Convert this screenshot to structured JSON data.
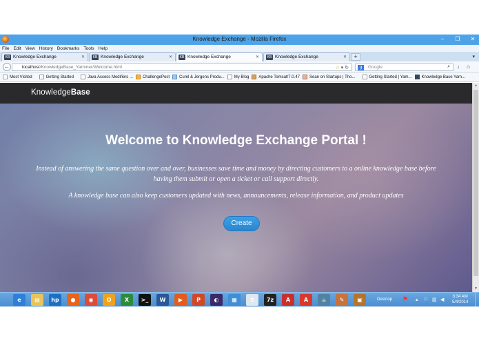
{
  "window": {
    "title": "Knowledge Exchange - Mozilla Firefox",
    "controls": [
      "–",
      "❐",
      "✕"
    ]
  },
  "menu": [
    "File",
    "Edit",
    "View",
    "History",
    "Bookmarks",
    "Tools",
    "Help"
  ],
  "tabs": [
    {
      "label": "Knowledge Exchange",
      "active": false
    },
    {
      "label": "Knowledge Exchange",
      "active": false
    },
    {
      "label": "Knowledge Exchange",
      "active": true
    },
    {
      "label": "Knowledge Exchange",
      "active": false
    }
  ],
  "tab_favicon": "KB",
  "address": {
    "host": "localhost",
    "path": "/KnowledgeBase_Yammer/Welcome.html"
  },
  "search": {
    "placeholder": "Google",
    "engine_icon": "g"
  },
  "bookmarks": [
    "Most Visited",
    "Getting Started",
    "Java Access Modifiers ...",
    "ChallengePost",
    "Curel & Jergens Produ...",
    "My Blog",
    "Apache Tomcat/7.0.47",
    "Sean on Startups | Tho...",
    "Getting Started | Yam...",
    "Knowledge Base Yam..."
  ],
  "site": {
    "brand_light": "Knowledge",
    "brand_bold": "Base",
    "hero_title": "Welcome to Knowledge Exchange Portal !",
    "hero_text_1": "Instead of answering the same question over and over, businesses save time and money by directing customers to a online knowledge base before having them submit or open a ticket or call support directly.",
    "hero_text_2": "A knowledge base can also keep customers updated with news, announcements, release information, and product updates",
    "create_label": "Create"
  },
  "taskbar": {
    "apps": [
      "internet-explorer",
      "file-explorer",
      "hp",
      "firefox",
      "chrome",
      "outlook",
      "excel",
      "command-prompt",
      "word",
      "media-player",
      "powerpoint",
      "eclipse",
      "network",
      "notepad",
      "7zip",
      "acrobat",
      "acrobat-reader",
      "java",
      "paint",
      "archive"
    ],
    "desktop_label": "Desktop",
    "time": "3:34 AM",
    "date": "5/4/2014"
  },
  "colors": {
    "accent": "#2b85cf",
    "titlebar": "#4ea3e8",
    "nav": "#2a2a2d"
  }
}
